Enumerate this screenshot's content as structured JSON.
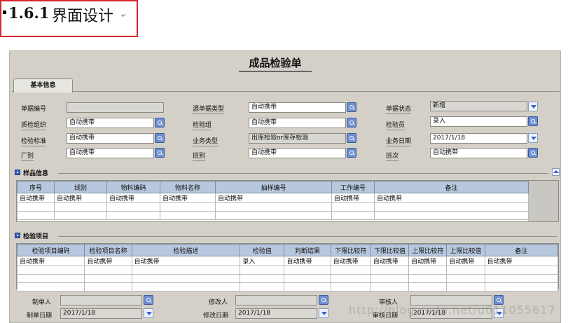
{
  "heading": {
    "number": "1.6.1",
    "title": "界面设计",
    "para_mark": "↵"
  },
  "form": {
    "title": "成品检验单",
    "tab_basic": "基本信息",
    "fields": {
      "doc_no": {
        "label": "单据编号",
        "value": ""
      },
      "source_type": {
        "label": "源单据类型",
        "value": "自动携带"
      },
      "doc_status": {
        "label": "单据状态",
        "value": "新增"
      },
      "qc_org": {
        "label": "质检组织",
        "value": "自动携带"
      },
      "qc_group": {
        "label": "检验组",
        "value": "自动携带"
      },
      "inspector": {
        "label": "检验员",
        "value": "录入"
      },
      "qc_standard": {
        "label": "检验标准",
        "value": "自动携带"
      },
      "biz_type": {
        "label": "业务类型",
        "value": "出库检验or库存检验"
      },
      "biz_date": {
        "label": "业务日期",
        "value": "2017/1/18"
      },
      "factory": {
        "label": "厂别",
        "value": "自动携带"
      },
      "shift_group": {
        "label": "班别",
        "value": "自动携带"
      },
      "shift": {
        "label": "班次",
        "value": "自动携带"
      }
    },
    "sample": {
      "title": "样品信息",
      "columns": [
        "序号",
        "线别",
        "物料编码",
        "物料名称",
        "抽样编号",
        "工作编号",
        "备注"
      ],
      "rows": [
        [
          "自动携带",
          "自动携带",
          "自动携带",
          "自动携带",
          "自动携带",
          "自动携带",
          "自动携带"
        ]
      ]
    },
    "items": {
      "title": "检验项目",
      "columns": [
        "检验项目编码",
        "检验项目名称",
        "检验描述",
        "检验值",
        "判断结果",
        "下限比较符",
        "下限比较值",
        "上限比较符",
        "上限比较值",
        "备注"
      ],
      "rows": [
        [
          "自动携带",
          "自动携带",
          "自动携带",
          "录入",
          "自动携带",
          "自动携带",
          "自动携带",
          "自动携带",
          "自动携带",
          "自动携带"
        ]
      ]
    },
    "footer": {
      "maker": {
        "label": "制单人",
        "value": ""
      },
      "modifier": {
        "label": "修改人",
        "value": ""
      },
      "auditor": {
        "label": "审核人",
        "value": ""
      },
      "make_date": {
        "label": "制单日期",
        "value": "2017/1/18"
      },
      "modify_date": {
        "label": "修改日期",
        "value": "2017/1/18"
      },
      "audit_date": {
        "label": "审核日期",
        "value": "2017/1/18"
      }
    }
  },
  "watermark": "http://blog.csdn.net/u011055617"
}
